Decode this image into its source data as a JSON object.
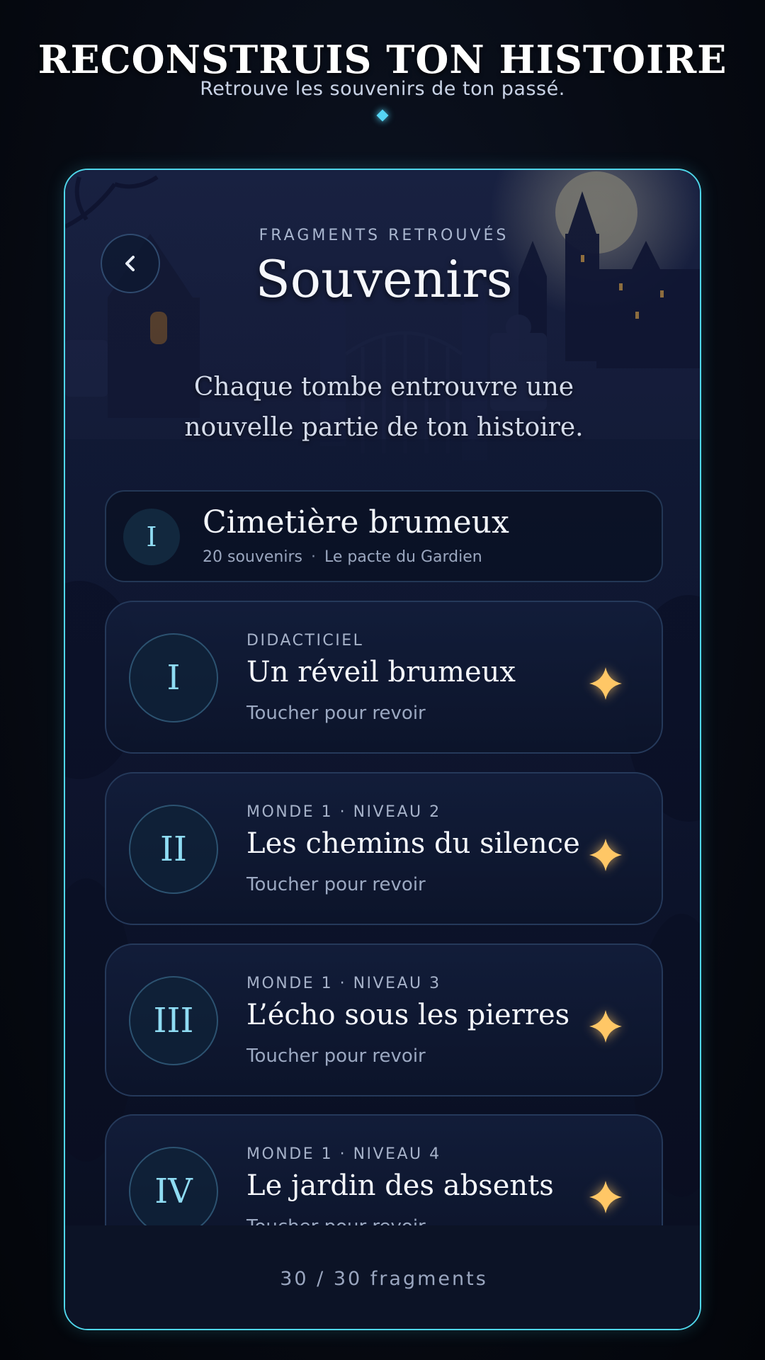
{
  "header": {
    "title": "RECONSTRUIS TON HISTOIRE",
    "subtitle": "Retrouve les souvenirs de ton passé."
  },
  "panel": {
    "back_icon": "chevron-left-icon",
    "eyebrow": "FRAGMENTS RETROUVÉS",
    "title": "Souvenirs",
    "description": "Chaque tombe entrouvre une nouvelle partie de ton histoire."
  },
  "world": {
    "numeral": "I",
    "name": "Cimetière brumeux",
    "count": "20 souvenirs",
    "separator": "·",
    "chapter": "Le pacte du Gardien"
  },
  "levels": [
    {
      "numeral": "I",
      "eyebrow": "DIDACTICIEL",
      "title": "Un réveil brumeux",
      "hint": "Toucher pour revoir"
    },
    {
      "numeral": "II",
      "eyebrow": "MONDE 1 · NIVEAU 2",
      "title": "Les chemins du silence",
      "hint": "Toucher pour revoir"
    },
    {
      "numeral": "III",
      "eyebrow": "MONDE 1 · NIVEAU 3",
      "title": "L’écho sous les pierres",
      "hint": "Toucher pour revoir"
    },
    {
      "numeral": "IV",
      "eyebrow": "MONDE 1 · NIVEAU 4",
      "title": "Le jardin des absents",
      "hint": "Toucher pour revoir"
    }
  ],
  "footer": {
    "progress": "30 / 30 fragments"
  },
  "colors": {
    "accent": "#4fd6ea",
    "numeral": "#8fdcf3",
    "sparkle": "#ffc766",
    "background": "#0b1226"
  }
}
